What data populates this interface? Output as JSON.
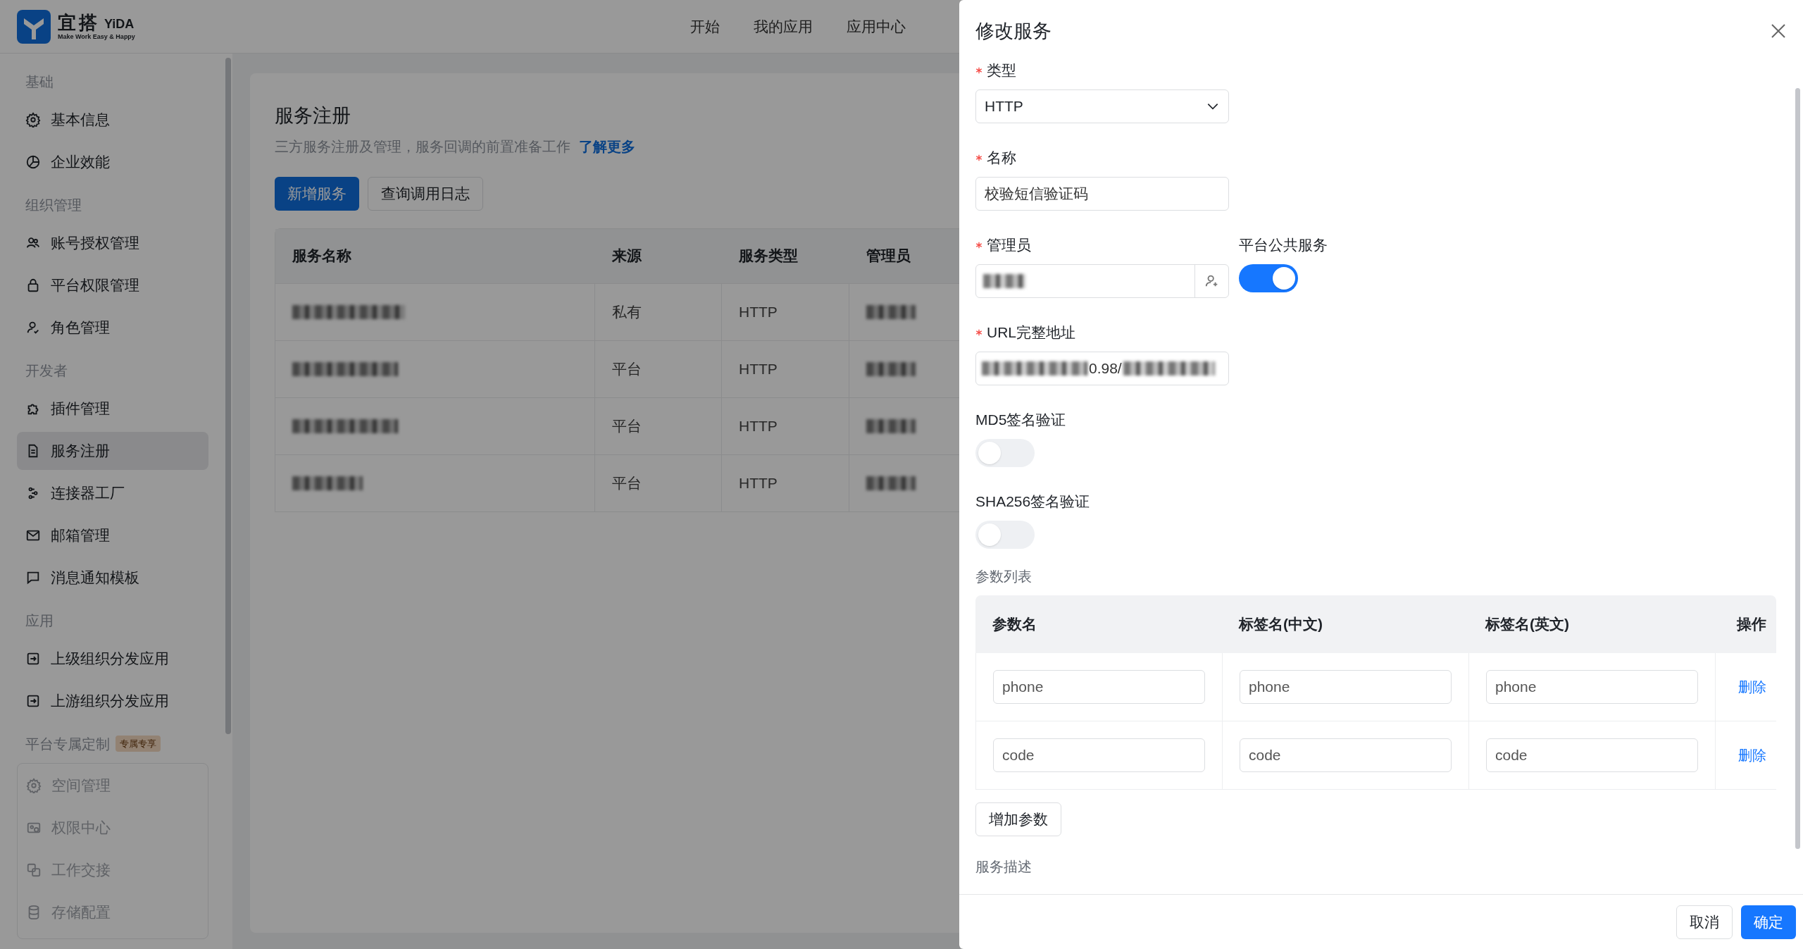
{
  "header": {
    "logo_cn": "宜搭",
    "logo_en": "YiDA",
    "slogan": "Make Work Easy & Happy",
    "nav": [
      "开始",
      "我的应用",
      "应用中心"
    ]
  },
  "sidebar": {
    "groups": [
      {
        "title": "基础",
        "disabled": false,
        "items": [
          {
            "label": "基本信息",
            "selected": false
          },
          {
            "label": "企业效能",
            "selected": false
          }
        ]
      },
      {
        "title": "组织管理",
        "disabled": false,
        "items": [
          {
            "label": "账号授权管理",
            "selected": false
          },
          {
            "label": "平台权限管理",
            "selected": false
          },
          {
            "label": "角色管理",
            "selected": false
          }
        ]
      },
      {
        "title": "开发者",
        "disabled": false,
        "items": [
          {
            "label": "插件管理",
            "selected": false
          },
          {
            "label": "服务注册",
            "selected": true
          },
          {
            "label": "连接器工厂",
            "selected": false
          },
          {
            "label": "邮箱管理",
            "selected": false
          },
          {
            "label": "消息通知模板",
            "selected": false
          }
        ]
      },
      {
        "title": "应用",
        "disabled": false,
        "items": [
          {
            "label": "上级组织分发应用",
            "selected": false
          },
          {
            "label": "上游组织分发应用",
            "selected": false
          }
        ]
      },
      {
        "title": "平台专属定制",
        "badge": "专属专享",
        "disabled": true,
        "items": [
          {
            "label": "空间管理",
            "selected": false
          },
          {
            "label": "权限中心",
            "selected": false
          },
          {
            "label": "工作交接",
            "selected": false
          },
          {
            "label": "存储配置",
            "selected": false
          }
        ]
      }
    ]
  },
  "page": {
    "title": "服务注册",
    "description": "三方服务注册及管理，服务回调的前置准备工作",
    "link": "了解更多",
    "buttons": [
      {
        "label": "新增服务",
        "primary": true
      },
      {
        "label": "查询调用日志",
        "primary": false
      }
    ],
    "table": {
      "columns": [
        "服务名称",
        "来源",
        "服务类型",
        "管理员"
      ],
      "rows": [
        {
          "source": "私有",
          "type": "HTTP"
        },
        {
          "source": "平台",
          "type": "HTTP"
        },
        {
          "source": "平台",
          "type": "HTTP"
        },
        {
          "source": "平台",
          "type": "HTTP"
        }
      ]
    }
  },
  "drawer": {
    "title": "修改服务",
    "fields": [
      {
        "kind": "select",
        "label": "类型",
        "required": true,
        "value": "HTTP"
      },
      {
        "kind": "text",
        "label": "名称",
        "required": true,
        "value": "校验短信验证码"
      },
      {
        "kind": "user",
        "label": "管理员",
        "required": true,
        "side": {
          "label": "平台公共服务",
          "on": true
        }
      },
      {
        "kind": "url",
        "label": "URL完整地址",
        "required": true,
        "value": "0.98/"
      },
      {
        "kind": "switch",
        "label": "MD5签名验证",
        "required": false,
        "on": false
      },
      {
        "kind": "switch",
        "label": "SHA256签名验证",
        "required": false,
        "on": false
      }
    ],
    "params": {
      "label": "参数列表",
      "columns": [
        "参数名",
        "标签名(中文)",
        "标签名(英文)",
        "操作"
      ],
      "rows": [
        {
          "name": "phone",
          "label_cn": "phone",
          "label_en": "phone",
          "action": "删除"
        },
        {
          "name": "code",
          "label_cn": "code",
          "label_en": "code",
          "action": "删除"
        }
      ],
      "add_button": "增加参数"
    },
    "description_label": "服务描述",
    "footer": [
      {
        "label": "取消",
        "primary": false
      },
      {
        "label": "确定",
        "primary": true
      }
    ]
  }
}
